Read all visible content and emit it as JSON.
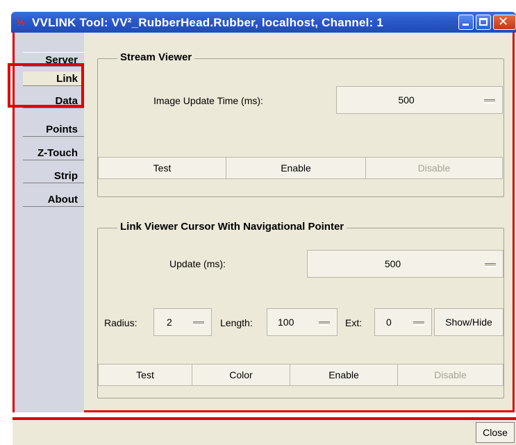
{
  "window": {
    "title": "VVLINK Tool: VV²_RubberHead.Rubber, localhost, Channel: 1",
    "icon_glyph": "½",
    "close_glyph": "✕"
  },
  "sidebar": {
    "tabs": [
      {
        "label": "Server"
      },
      {
        "label": "Link"
      },
      {
        "label": "Data"
      },
      {
        "label": "Points"
      },
      {
        "label": "Z-Touch"
      },
      {
        "label": "Strip"
      },
      {
        "label": "About"
      }
    ]
  },
  "stream_viewer": {
    "title": "Stream Viewer",
    "update_label": "Image Update Time (ms):",
    "update_value": "500",
    "buttons": {
      "test": "Test",
      "enable": "Enable",
      "disable": "Disable"
    }
  },
  "link_viewer": {
    "title": "Link Viewer Cursor With Navigational Pointer",
    "update_label": "Update (ms):",
    "update_value": "500",
    "radius_label": "Radius:",
    "radius_value": "2",
    "length_label": "Length:",
    "length_value": "100",
    "ext_label": "Ext:",
    "ext_value": "0",
    "show_hide": "Show/Hide",
    "buttons": {
      "test": "Test",
      "color": "Color",
      "enable": "Enable",
      "disable": "Disable"
    }
  },
  "footer": {
    "close": "Close"
  },
  "colors": {
    "highlight": "#e00000",
    "titlebar": "#2a58c8",
    "panel": "#ece9d8"
  }
}
